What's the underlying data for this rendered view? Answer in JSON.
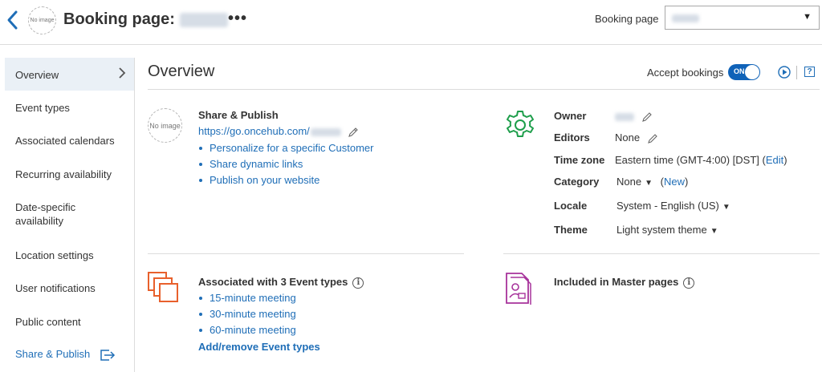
{
  "header": {
    "title": "Booking page:",
    "more_label": "•••",
    "avatar_text": "No image",
    "booking_page_label": "Booking page",
    "select_caret": "▼"
  },
  "sidebar": {
    "items": [
      {
        "label": "Overview"
      },
      {
        "label": "Event types"
      },
      {
        "label": "Associated calendars"
      },
      {
        "label": "Recurring availability"
      },
      {
        "label": "Date-specific availability"
      },
      {
        "label": "Location settings"
      },
      {
        "label": "User notifications"
      },
      {
        "label": "Public content"
      },
      {
        "label": "Share & Publish"
      }
    ]
  },
  "main": {
    "title": "Overview",
    "accept_bookings_label": "Accept bookings",
    "toggle_label": "ON",
    "help_label": "?"
  },
  "share": {
    "avatar_text": "No image",
    "title": "Share & Publish",
    "url": "https://go.oncehub.com/",
    "links": [
      "Personalize for a specific Customer",
      "Share dynamic links",
      "Publish on your website"
    ]
  },
  "details": {
    "owner_label": "Owner",
    "editors_label": "Editors",
    "editors_value": "None",
    "timezone_label": "Time zone",
    "timezone_value": "Eastern time (GMT-4:00) [DST] (",
    "timezone_edit": "Edit",
    "timezone_close": ")",
    "category_label": "Category",
    "category_value": "None",
    "category_new_open": "(",
    "category_new": "New",
    "category_new_close": ")",
    "locale_label": "Locale",
    "locale_value": "System - English (US)",
    "theme_label": "Theme",
    "theme_value": "Light system theme",
    "caret": "▼"
  },
  "event_types": {
    "title": "Associated with 3 Event types",
    "items": [
      "15-minute meeting",
      "30-minute meeting",
      "60-minute meeting"
    ],
    "add_remove_label": "Add/remove Event types"
  },
  "master_pages": {
    "title": "Included in Master pages"
  },
  "info_icon_char": "i",
  "colors": {
    "accent": "#1f6eb7",
    "toggle_on": "#0f62b8",
    "gear_green": "#1e9e4b",
    "event_orange": "#e8602c",
    "master_magenta": "#a7339b"
  }
}
